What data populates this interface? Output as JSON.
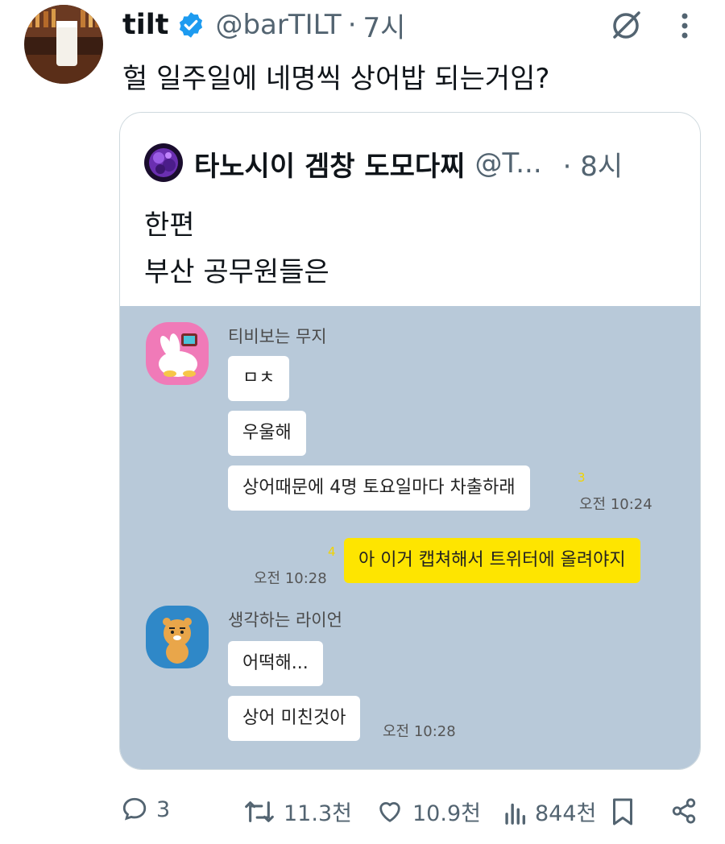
{
  "tweet": {
    "author_name": "tilt",
    "author_handle": "@barTILT",
    "time_sep": "·",
    "time": "7시",
    "text": "헐 일주일에 네명씩 상어밥 되는거임?"
  },
  "quote": {
    "author_name": "타노시이 겜창 도모다찌",
    "author_handle": "@T...",
    "time": "· 8시",
    "line1": "한편",
    "line2": "부산 공무원들은"
  },
  "chat": {
    "sender1": "티비보는 무지",
    "msg1": "ㅁㅊ",
    "msg2": "우울해",
    "msg3": "상어때문에 4명 토요일마다 차출하래",
    "unread3": "3",
    "time1": "오전 10:24",
    "my_msg": "아 이거 캡쳐해서 트위터에 올려야지",
    "unread4": "4",
    "time2": "오전 10:28",
    "sender2": "생각하는 라이언",
    "msg4": "어떡해...",
    "msg5": "상어 미친것아",
    "time3": "오전 10:28"
  },
  "actions": {
    "replies": "3",
    "retweets": "11.3천",
    "likes": "10.9천",
    "views": "844천"
  },
  "colors": {
    "chat_bg": "#b8c9d9",
    "my_bubble": "#fee500",
    "verified": "#1d9bf0",
    "muted_text": "#536471"
  }
}
